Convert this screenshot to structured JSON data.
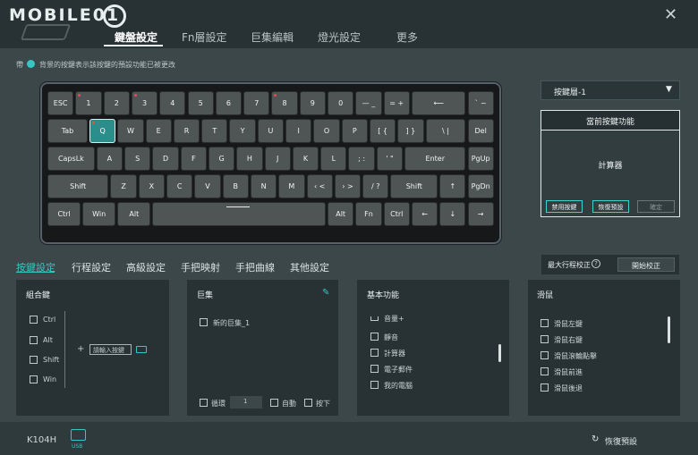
{
  "app": {
    "logo_text": "MOBILE01",
    "close_glyph": "✕",
    "close_icon": "close-icon"
  },
  "nav": {
    "tabs": [
      {
        "label": "鍵盤設定",
        "active": true
      },
      {
        "label": "Fn層設定",
        "active": false
      },
      {
        "label": "巨集編輯",
        "active": false
      },
      {
        "label": "燈光設定",
        "active": false
      },
      {
        "label": "更多",
        "active": false
      }
    ]
  },
  "legend": {
    "prefix": "帶",
    "text": "背景的按鍵表示該按鍵的預設功能已被更改",
    "dot_color": "#37c6c3"
  },
  "keyboard": {
    "rows": [
      [
        "ESC",
        "1",
        "2",
        "3",
        "4",
        "5",
        "6",
        "7",
        "8",
        "9",
        "0",
        "— _",
        "= +",
        "⟵",
        "` ~"
      ],
      [
        "Tab",
        "Q",
        "W",
        "E",
        "R",
        "T",
        "Y",
        "U",
        "I",
        "O",
        "P",
        "[ {",
        "] }",
        "\\ |",
        "Del"
      ],
      [
        "CapsLk",
        "A",
        "S",
        "D",
        "F",
        "G",
        "H",
        "J",
        "K",
        "L",
        "; :",
        "' \"",
        "Enter",
        "PgUp"
      ],
      [
        "Shift",
        "Z",
        "X",
        "C",
        "V",
        "B",
        "N",
        "M",
        "‹ <",
        "› >",
        "/ ?",
        "Shift",
        "↑",
        "PgDn"
      ],
      [
        "Ctrl",
        "Win",
        "Alt",
        "",
        "Alt",
        "Fn",
        "Ctrl",
        "←",
        "↓",
        "→"
      ]
    ],
    "highlighted_key": "Q",
    "accent_color": "#2b8e8a"
  },
  "layer": {
    "selected": "按鍵層-1",
    "arrow_glyph": "▼"
  },
  "current_function": {
    "title": "當前按鍵功能",
    "value": "計算器",
    "disable_button": "禁用按鍵",
    "restore_button": "恢復預設",
    "confirm_button": "確定"
  },
  "subtabs": [
    {
      "label": "按鍵設定",
      "active": true
    },
    {
      "label": "行程設定",
      "active": false
    },
    {
      "label": "高級設定",
      "active": false
    },
    {
      "label": "手把映射",
      "active": false
    },
    {
      "label": "手把曲線",
      "active": false
    },
    {
      "label": "其他設定",
      "active": false
    }
  ],
  "max_travel": {
    "label": "最大行程校正",
    "help_glyph": "?",
    "button": "開始校正"
  },
  "combo_panel": {
    "title": "組合鍵",
    "modifiers": [
      "Ctrl",
      "Alt",
      "Shift",
      "Win"
    ],
    "plus_glyph": "+",
    "input_placeholder": "請輸入按鍵"
  },
  "macro_panel": {
    "title": "巨集",
    "items": [
      "新的巨集_1"
    ],
    "loop_label": "循環",
    "loop_value": "1",
    "auto_label": "自動",
    "press_label": "按下"
  },
  "basic_panel": {
    "title": "基本功能",
    "items": [
      "音量+",
      "靜音",
      "計算器",
      "電子郵件",
      "我的電腦"
    ]
  },
  "mouse_panel": {
    "title": "滑鼠",
    "items": [
      "滑鼠左鍵",
      "滑鼠右鍵",
      "滑鼠滾輪點擊",
      "滑鼠前進",
      "滑鼠後退"
    ]
  },
  "footer": {
    "model": "K104H",
    "connection": "USB",
    "restore": "恢復預設",
    "restore_glyph": "↻"
  }
}
